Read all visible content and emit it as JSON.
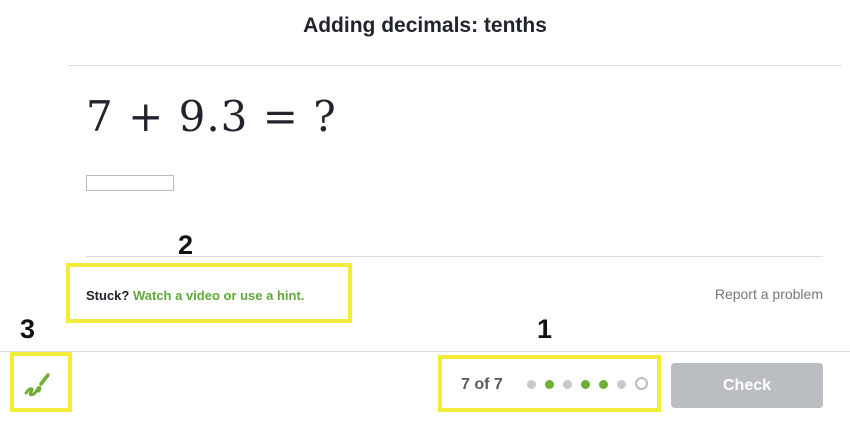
{
  "header": {
    "title": "Adding decimals: tenths"
  },
  "problem": {
    "equation": "7 + 9.3 = ?",
    "answer_value": "",
    "answer_placeholder": ""
  },
  "help": {
    "stuck_label": "Stuck?",
    "hint_link": "Watch a video or use a hint."
  },
  "report_link": "Report a problem",
  "footer": {
    "progress_text": "7 of 7",
    "dots": [
      "done",
      "correct",
      "done",
      "correct",
      "correct",
      "done",
      "current"
    ],
    "check_label": "Check"
  },
  "annotations": {
    "a1": "1",
    "a2": "2",
    "a3": "3"
  },
  "colors": {
    "accent_green": "#6dae35",
    "highlight_yellow": "#f4ec3a",
    "check_disabled": "#babec2"
  },
  "icons": {
    "scratchpad": "scratchpad-pencil-icon"
  }
}
